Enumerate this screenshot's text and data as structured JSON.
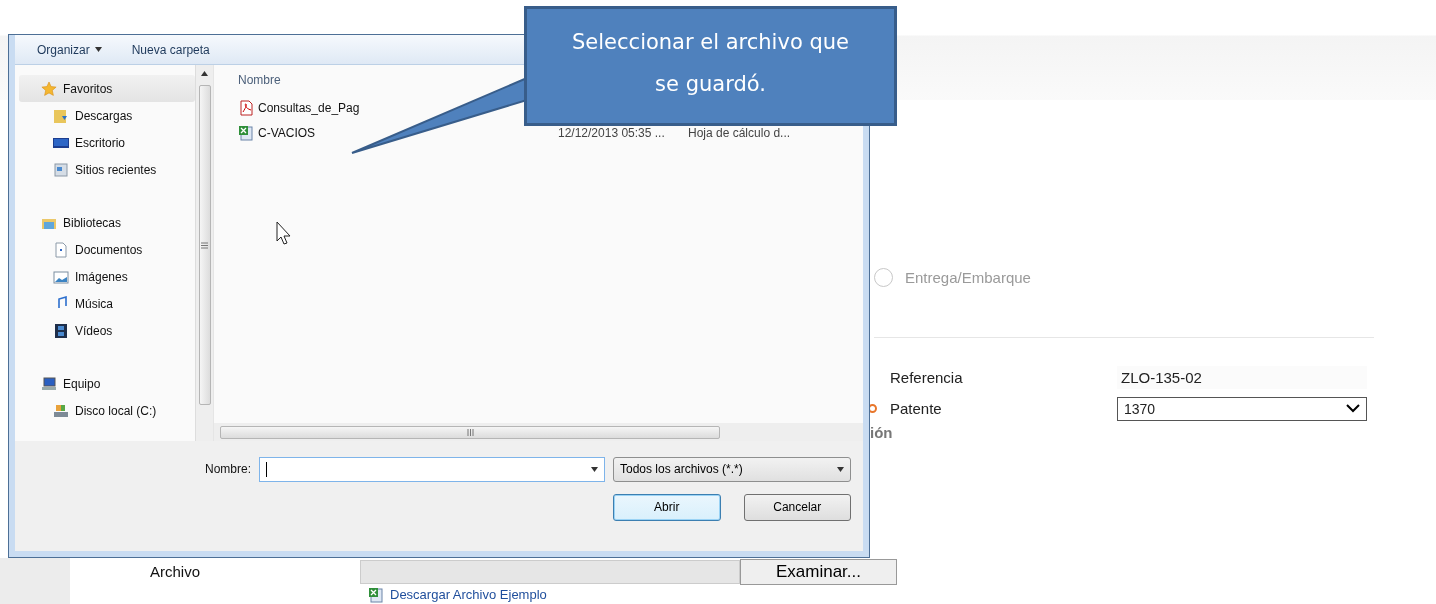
{
  "page": {
    "radio": {
      "label": "Entrega/Embarque",
      "checked": false
    },
    "fields": [
      {
        "label": "Referencia",
        "value": "ZLO-135-02",
        "required": false,
        "kind": "text"
      },
      {
        "label": "Patente",
        "value": "1370",
        "required": true,
        "kind": "select"
      }
    ],
    "section_heading": "ión",
    "file_row": {
      "label": "Archivo",
      "button": "Examinar..."
    },
    "download_link": "Descargar Archivo Ejemplo"
  },
  "dialog": {
    "toolbar": [
      {
        "label": "Organizar",
        "dropdown": true
      },
      {
        "label": "Nueva carpeta",
        "dropdown": false
      }
    ],
    "nav": [
      {
        "label": "Favoritos",
        "selected": true,
        "children": [
          {
            "label": "Descargas",
            "selected": false
          },
          {
            "label": "Escritorio",
            "selected": false
          },
          {
            "label": "Sitios recientes",
            "selected": false
          }
        ]
      },
      {
        "label": "Bibliotecas",
        "selected": false,
        "children": [
          {
            "label": "Documentos",
            "selected": false
          },
          {
            "label": "Imágenes",
            "selected": false
          },
          {
            "label": "Música",
            "selected": false
          },
          {
            "label": "Vídeos",
            "selected": false
          }
        ]
      },
      {
        "label": "Equipo",
        "selected": false,
        "children": [
          {
            "label": "Disco local (C:)",
            "selected": false
          }
        ]
      }
    ],
    "columns": [
      "Nombre"
    ],
    "files": [
      {
        "name": "Consultas_de_Pag",
        "kind": "pdf"
      },
      {
        "name": "C-VACIOS",
        "kind": "spreadsheet",
        "date": "12/12/2013 05:35 ...",
        "type": "Hoja de cálculo d..."
      }
    ],
    "name_label": "Nombre:",
    "filter": "Todos los archivos (*.*)",
    "buttons": [
      {
        "label": "Abrir",
        "selected": true
      },
      {
        "label": "Cancelar",
        "selected": false
      }
    ]
  },
  "callout": "Seleccionar el archivo que se guardó."
}
